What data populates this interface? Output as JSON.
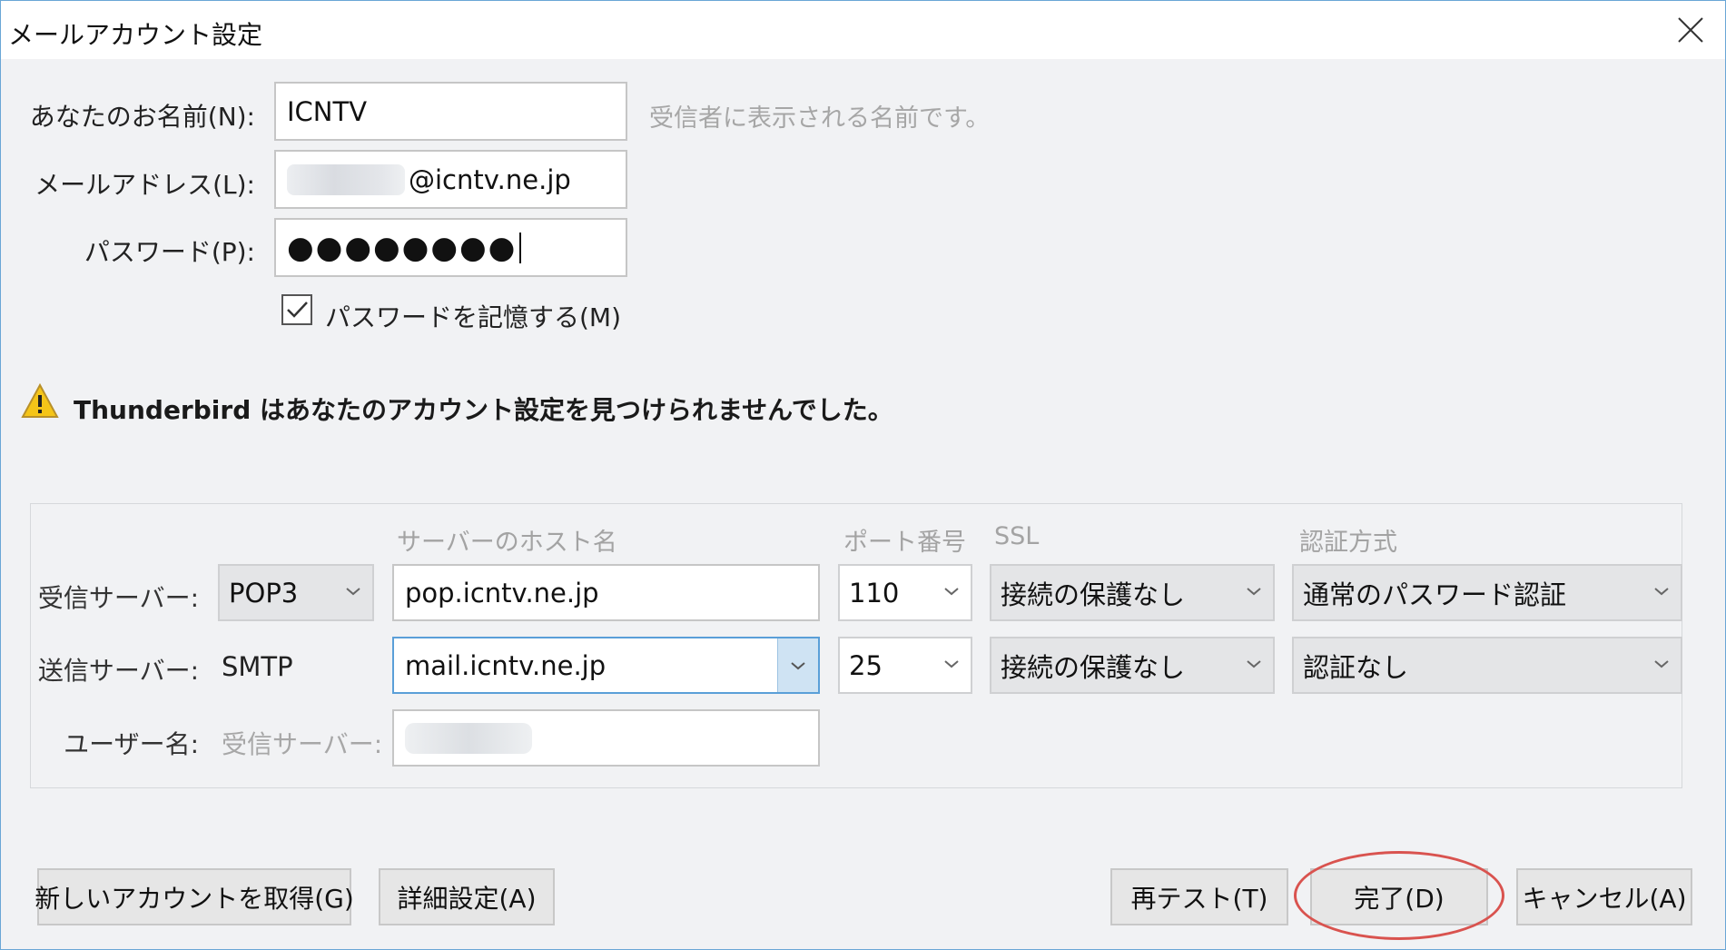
{
  "window": {
    "title": "メールアカウント設定"
  },
  "form": {
    "name_label": "あなたのお名前(N):",
    "name_value": "ICNTV",
    "name_hint": "受信者に表示される名前です。",
    "email_label": "メールアドレス(L):",
    "email_value": "@icntv.ne.jp",
    "password_label": "パスワード(P):",
    "password_value": "●●●●●●●●",
    "remember_label": "パスワードを記憶する(M)",
    "remember_checked": true
  },
  "warning": {
    "text": "Thunderbird はあなたのアカウント設定を見つけられませんでした。",
    "icon": "warning-icon"
  },
  "server": {
    "headers": {
      "hostname": "サーバーのホスト名",
      "port": "ポート番号",
      "ssl": "SSL",
      "auth": "認証方式"
    },
    "incoming": {
      "label": "受信サーバー:",
      "protocol": "POP3",
      "hostname": "pop.icntv.ne.jp",
      "port": "110",
      "ssl": "接続の保護なし",
      "auth": "通常のパスワード認証"
    },
    "outgoing": {
      "label": "送信サーバー:",
      "protocol": "SMTP",
      "hostname": "mail.icntv.ne.jp",
      "port": "25",
      "ssl": "接続の保護なし",
      "auth": "認証なし"
    },
    "username": {
      "label": "ユーザー名:",
      "scope": "受信サーバー:"
    }
  },
  "buttons": {
    "new_account": "新しいアカウントを取得(G)",
    "advanced": "詳細設定(A)",
    "retest": "再テスト(T)",
    "done": "完了(D)",
    "cancel": "キャンセル(A)"
  },
  "colors": {
    "accent_border": "#6aa6d6",
    "highlight_ring": "#d9534f",
    "warning_fill": "#f5c518"
  }
}
